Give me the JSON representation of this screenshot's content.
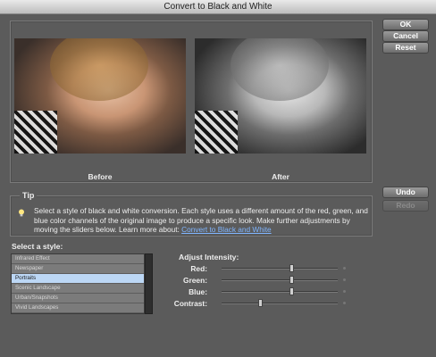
{
  "window": {
    "title": "Convert to Black and White"
  },
  "buttons": {
    "ok": "OK",
    "cancel": "Cancel",
    "reset": "Reset",
    "undo": "Undo",
    "redo": "Redo"
  },
  "preview": {
    "before_label": "Before",
    "after_label": "After"
  },
  "tip": {
    "title": "Tip",
    "text": "Select a style of black and white conversion. Each style uses a different amount of the red, green, and blue color channels of the original image to produce a specific look. Make further adjustments by moving the sliders below. Learn more about: ",
    "link": "Convert to Black and White"
  },
  "styles": {
    "label": "Select a style:",
    "items": [
      "Infrared Effect",
      "Newspaper",
      "Portraits",
      "Scenic Landscape",
      "Urban/Snapshots",
      "Vivid Landscapes"
    ],
    "selected": "Portraits"
  },
  "intensity": {
    "label": "Adjust Intensity:",
    "sliders": [
      {
        "name": "Red:",
        "value": 0.61
      },
      {
        "name": "Green:",
        "value": 0.61
      },
      {
        "name": "Blue:",
        "value": 0.61
      },
      {
        "name": "Contrast:",
        "value": 0.33
      }
    ]
  },
  "colors": {
    "background": "#5b5b5b",
    "selection": "#bcd7f5",
    "link": "#7fb5ff"
  }
}
